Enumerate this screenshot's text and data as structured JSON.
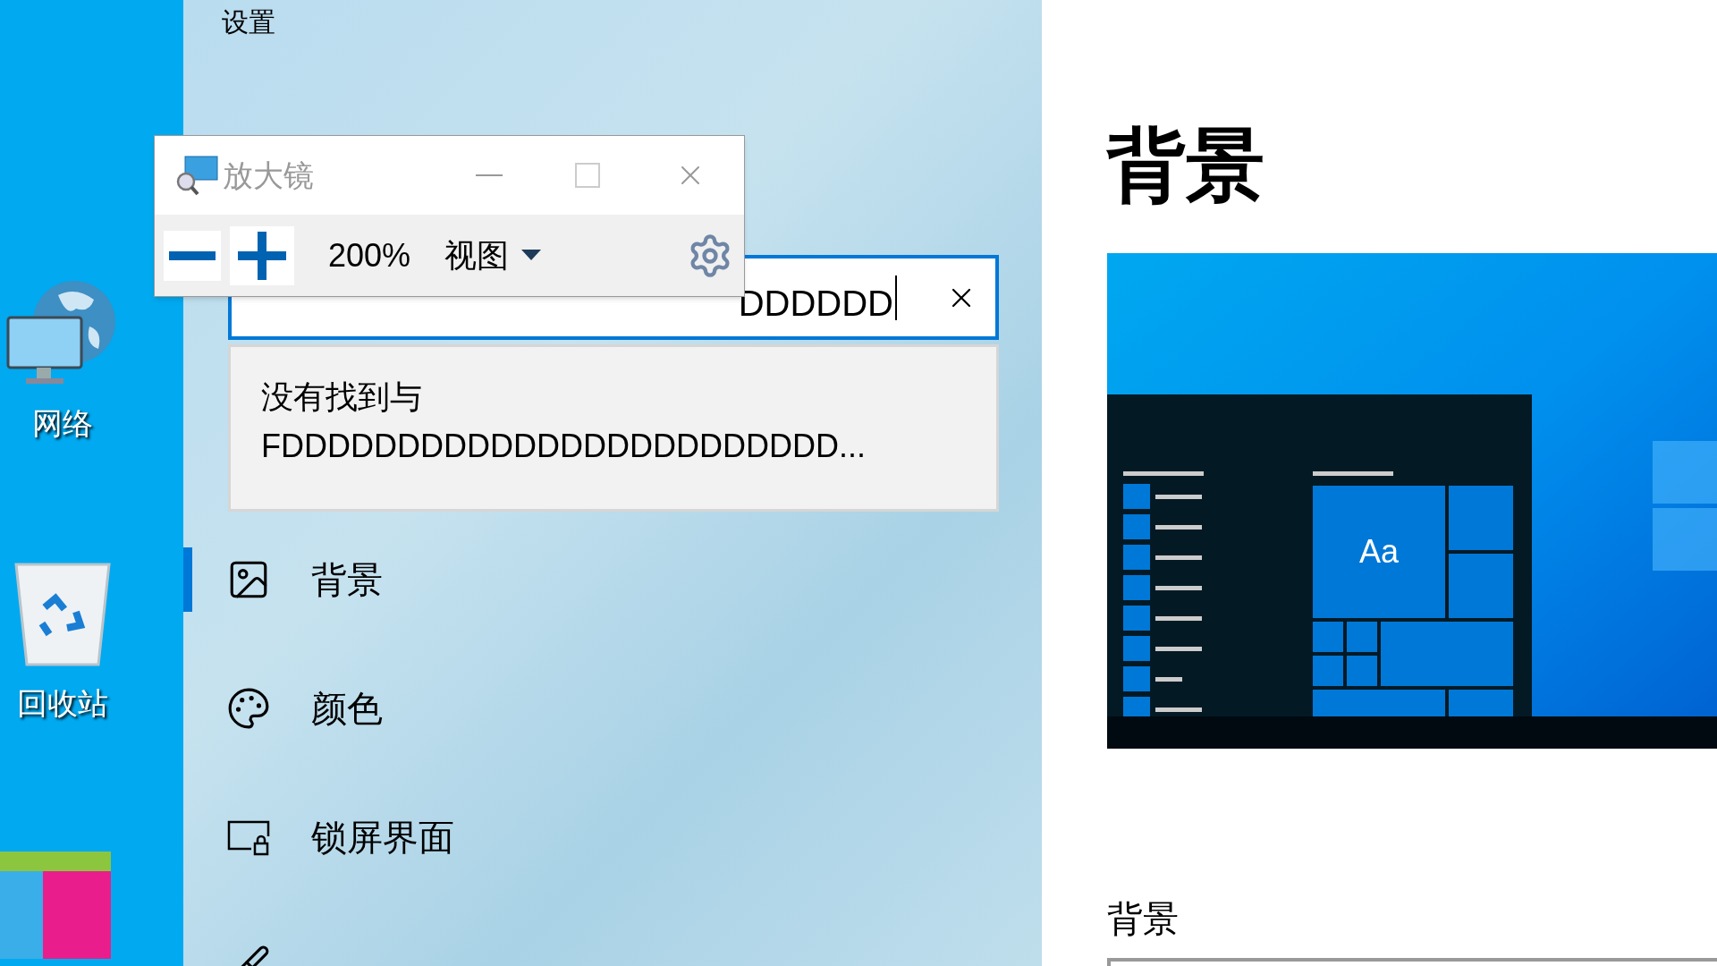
{
  "desktop": {
    "icons": [
      {
        "kind": "network",
        "label": "网络"
      },
      {
        "kind": "recycle",
        "label": "回收站"
      },
      {
        "kind": "tiles"
      }
    ]
  },
  "settings": {
    "app_title": "设置",
    "search": {
      "value": "DDDDDD"
    },
    "search_message": "没有找到与 FDDDDDDDDDDDDDDDDDDDDDDDD...",
    "nav": [
      {
        "kind": "background",
        "label": "背景",
        "selected": true
      },
      {
        "kind": "colors",
        "label": "颜色",
        "selected": false
      },
      {
        "kind": "lock",
        "label": "锁屏界面",
        "selected": false
      },
      {
        "kind": "theme",
        "selected": false
      }
    ]
  },
  "magnifier": {
    "title": "放大镜",
    "zoom": "200%",
    "view_menu": "视图"
  },
  "page": {
    "title": "背景",
    "preview_tile_label": "Aa",
    "section_label": "背景"
  }
}
